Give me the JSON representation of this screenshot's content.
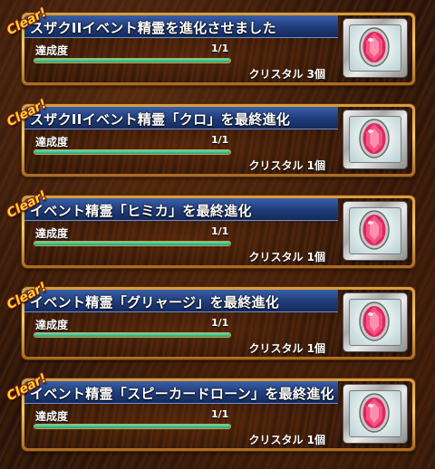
{
  "screen": {
    "clear_label": "Clear!",
    "progress_label": "達成度"
  },
  "missions": [
    {
      "title": "スザクIIイベント精霊を進化させました",
      "progress_text": "1/1",
      "progress": 1.0,
      "reward": "クリスタル 3個",
      "reward_icon": "crystal-gem-icon"
    },
    {
      "title": "スザクIIイベント精霊「クロ」を最終進化",
      "progress_text": "1/1",
      "progress": 1.0,
      "reward": "クリスタル 1個",
      "reward_icon": "crystal-gem-icon"
    },
    {
      "title": "イベント精霊「ヒミカ」を最終進化",
      "progress_text": "1/1",
      "progress": 1.0,
      "reward": "クリスタル 1個",
      "reward_icon": "crystal-gem-icon"
    },
    {
      "title": "イベント精霊「グリャージ」を最終進化",
      "progress_text": "1/1",
      "progress": 1.0,
      "reward": "クリスタル 1個",
      "reward_icon": "crystal-gem-icon"
    },
    {
      "title": "イベント精霊「スピーカードローン」を最終進化",
      "progress_text": "1/1",
      "progress": 1.0,
      "reward": "クリスタル 1個",
      "reward_icon": "crystal-gem-icon"
    }
  ],
  "colors": {
    "title_bar": "#1f3c7a",
    "progress_fill": "#1ea077",
    "frame_gold": "#f3c867",
    "clear_badge": "#ffd23a",
    "gem": "#e0245e"
  }
}
